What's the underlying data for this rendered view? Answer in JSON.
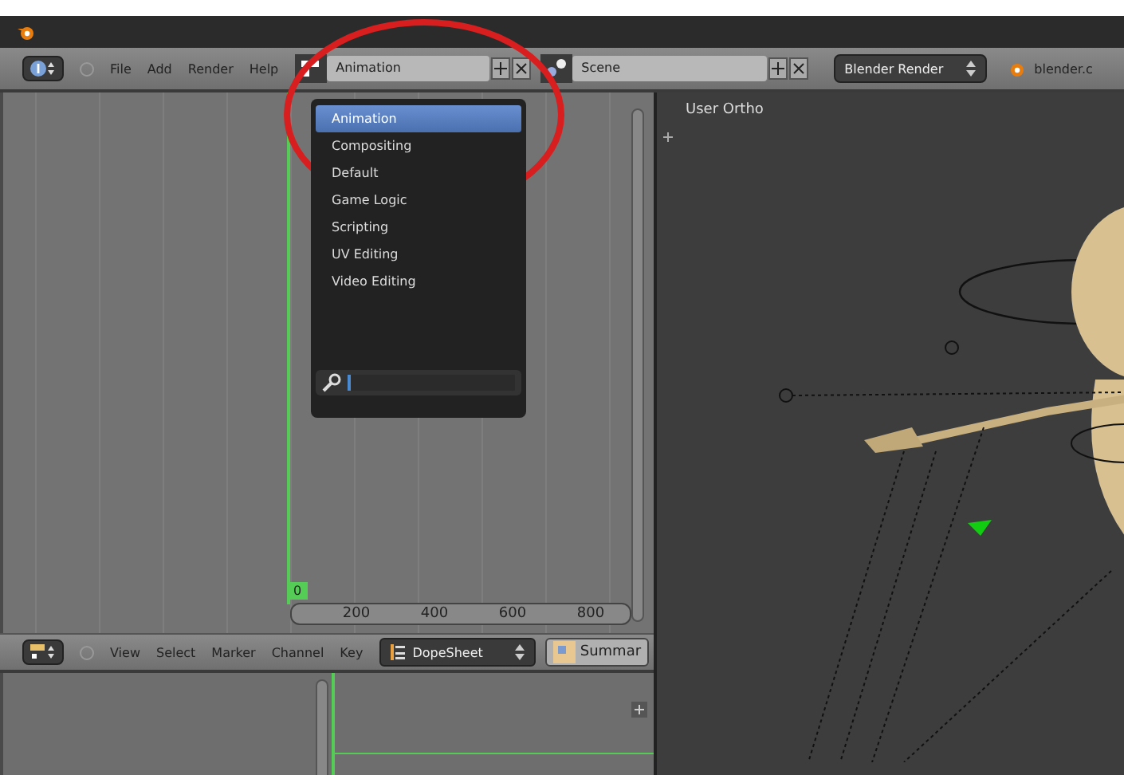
{
  "info_header": {
    "menus": [
      "File",
      "Add",
      "Render",
      "Help"
    ],
    "screen_layout": "Animation",
    "scene": "Scene",
    "render_engine": "Blender Render",
    "file_name": "blender.c"
  },
  "layout_menu": {
    "items": [
      {
        "label": "Animation",
        "selected": true
      },
      {
        "label": "Compositing",
        "selected": false
      },
      {
        "label": "Default",
        "selected": false
      },
      {
        "label": "Game Logic",
        "selected": false
      },
      {
        "label": "Scripting",
        "selected": false
      },
      {
        "label": "UV Editing",
        "selected": false
      },
      {
        "label": "Video Editing",
        "selected": false
      }
    ]
  },
  "timeline": {
    "current_frame": "0",
    "ruler_ticks": [
      "200",
      "400",
      "600",
      "800"
    ]
  },
  "dopesheet_header": {
    "menus": [
      "View",
      "Select",
      "Marker",
      "Channel",
      "Key"
    ],
    "mode": "DopeSheet",
    "filter": "Summar"
  },
  "viewport": {
    "label": "User Ortho"
  }
}
